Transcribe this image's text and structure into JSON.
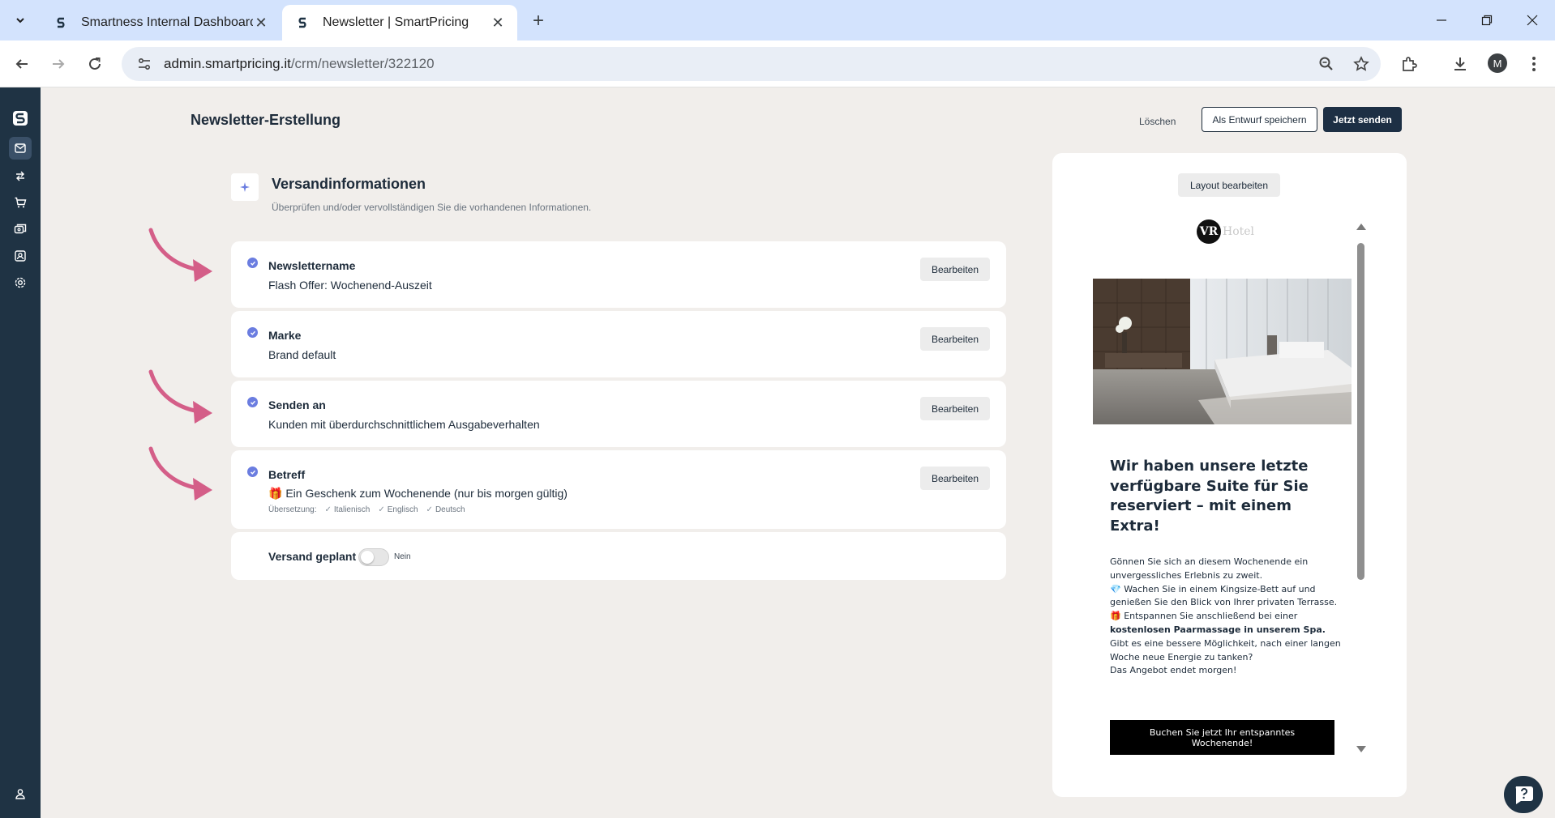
{
  "browser": {
    "tabs": [
      {
        "title": "Smartness Internal Dashboard",
        "active": false
      },
      {
        "title": "Newsletter | SmartPricing",
        "active": true
      }
    ],
    "url_host": "admin.smartpricing.it",
    "url_path": "/crm/newsletter/322120",
    "profile_initial": "M"
  },
  "header": {
    "title": "Newsletter-Erstellung",
    "delete_label": "Löschen",
    "draft_label": "Als Entwurf speichern",
    "send_label": "Jetzt senden"
  },
  "section": {
    "title": "Versandinformationen",
    "subtitle": "Überprüfen und/oder vervollständigen Sie die vorhandenen Informationen."
  },
  "cards": [
    {
      "label": "Newslettername",
      "value": "Flash Offer: Wochenend-Auszeit",
      "edit": "Bearbeiten"
    },
    {
      "label": "Marke",
      "value": "Brand default",
      "edit": "Bearbeiten"
    },
    {
      "label": "Senden an",
      "value": "Kunden mit überdurchschnittlichem Ausgabeverhalten",
      "edit": "Bearbeiten"
    },
    {
      "label": "Betreff",
      "value": "🎁 Ein Geschenk zum Wochenende (nur bis morgen gültig)",
      "edit": "Bearbeiten",
      "translation_label": "Übersetzung:",
      "translations": [
        "Italienisch",
        "Englisch",
        "Deutsch"
      ]
    }
  ],
  "schedule": {
    "label": "Versand geplant",
    "toggle_state": "Nein",
    "enabled": false
  },
  "preview": {
    "layout_button": "Layout bearbeiten",
    "logo_initials": "VR",
    "logo_text": "Hotel",
    "headline": "Wir haben unsere letzte verfügbare Suite für Sie reserviert – mit einem Extra!",
    "body_lines": {
      "l1": "Gönnen Sie sich an diesem Wochenende ein unvergessliches Erlebnis zu zweit.",
      "l2": "💎 Wachen Sie in einem Kingsize-Bett auf und genießen Sie den Blick von Ihrer privaten Terrasse.",
      "l3a": "🎁 Entspannen Sie anschließend bei einer ",
      "l3b": "kostenlosen Paarmassage in unserem Spa.",
      "l4": "Gibt es eine bessere Möglichkeit, nach einer langen Woche neue Energie zu tanken?",
      "l5": "Das Angebot endet morgen!"
    },
    "cta": "Buchen Sie jetzt Ihr entspanntes Wochenende!"
  },
  "colors": {
    "sidebar": "#1f3344",
    "accent_check": "#6b7de0",
    "arrow": "#d45e88",
    "page_bg": "#f1eeeb"
  },
  "icons": [
    "chevron-down-icon",
    "favicon-s-icon",
    "close-icon",
    "plus-icon",
    "minimize-icon",
    "restore-icon",
    "close-window-icon",
    "back-icon",
    "forward-icon",
    "reload-icon",
    "site-info-icon",
    "zoom-icon",
    "star-icon",
    "extensions-icon",
    "download-icon",
    "menu-dots-icon",
    "app-logo-icon",
    "mail-icon",
    "swap-icon",
    "cart-icon",
    "tickets-icon",
    "contacts-icon",
    "settings-icon",
    "user-icon",
    "sparkle-icon",
    "check-icon",
    "help-chat-icon"
  ]
}
